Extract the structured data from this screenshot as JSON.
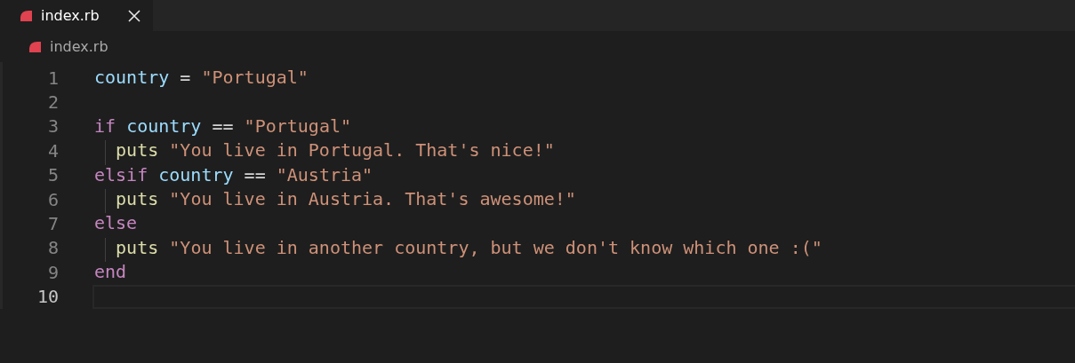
{
  "tabs": [
    {
      "label": "index.rb",
      "selected": true,
      "closable": true
    }
  ],
  "breadcrumb": {
    "label": "index.rb"
  },
  "editor": {
    "lines": [
      {
        "number": "1",
        "current": false,
        "indented": false,
        "tokens": [
          {
            "kind": "variable",
            "text": "country"
          },
          {
            "kind": "operator",
            "text": " = "
          },
          {
            "kind": "string",
            "text": "\"Portugal\""
          }
        ]
      },
      {
        "number": "2",
        "current": false,
        "indented": false
      },
      {
        "number": "3",
        "current": false,
        "indented": false,
        "tokens": [
          {
            "kind": "keyword",
            "text": "if "
          },
          {
            "kind": "variable",
            "text": "country"
          },
          {
            "kind": "operator",
            "text": " == "
          },
          {
            "kind": "string",
            "text": "\"Portugal\""
          }
        ]
      },
      {
        "number": "4",
        "current": false,
        "indented": true,
        "tokens": [
          {
            "kind": "function",
            "text": "puts "
          },
          {
            "kind": "string",
            "text": "\"You live in Portugal. That's nice!\""
          }
        ]
      },
      {
        "number": "5",
        "current": false,
        "indented": false,
        "tokens": [
          {
            "kind": "keyword",
            "text": "elsif "
          },
          {
            "kind": "variable",
            "text": "country"
          },
          {
            "kind": "operator",
            "text": " == "
          },
          {
            "kind": "string",
            "text": "\"Austria\""
          }
        ]
      },
      {
        "number": "6",
        "current": false,
        "indented": true,
        "tokens": [
          {
            "kind": "function",
            "text": "puts "
          },
          {
            "kind": "string",
            "text": "\"You live in Austria. That's awesome!\""
          }
        ]
      },
      {
        "number": "7",
        "current": false,
        "indented": false,
        "tokens": [
          {
            "kind": "keyword",
            "text": "else"
          }
        ]
      },
      {
        "number": "8",
        "current": false,
        "indented": true,
        "tokens": [
          {
            "kind": "function",
            "text": "puts "
          },
          {
            "kind": "string",
            "text": "\"You live in another country, but we don't know which one :(\""
          }
        ]
      },
      {
        "number": "9",
        "current": false,
        "indented": false,
        "tokens": [
          {
            "kind": "keyword",
            "text": "end"
          }
        ]
      },
      {
        "number": "10",
        "current": true,
        "indented": false
      }
    ]
  }
}
